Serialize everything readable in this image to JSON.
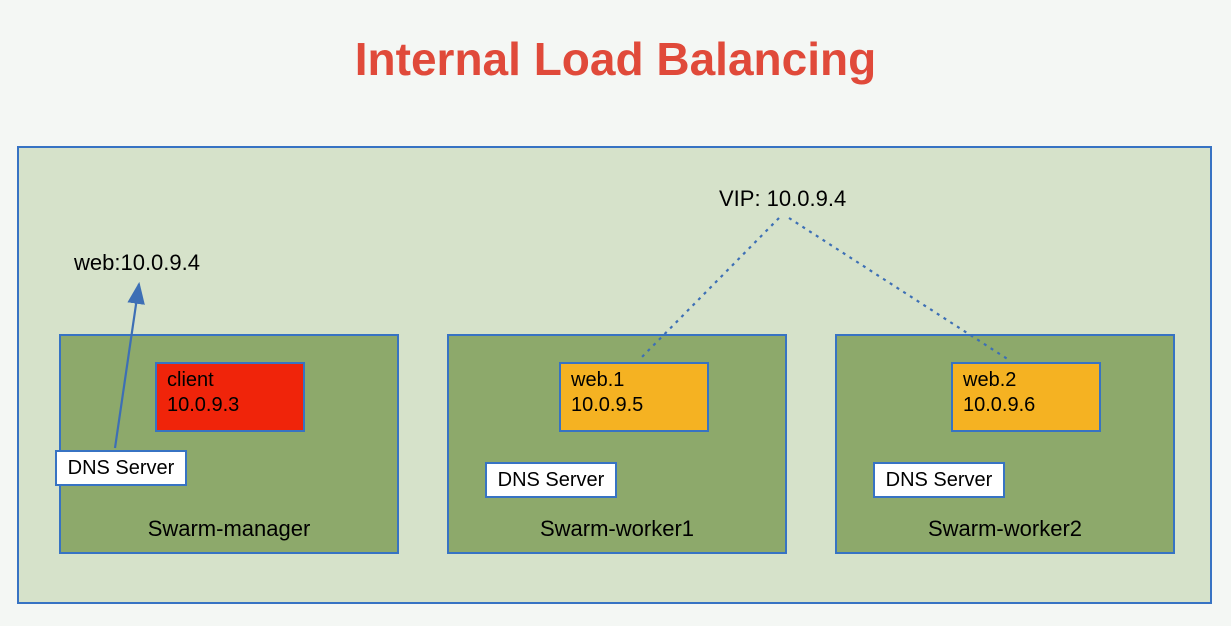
{
  "title": "Internal Load Balancing",
  "labels": {
    "vip": "VIP: 10.0.9.4",
    "web": "web:10.0.9.4",
    "dns": "DNS Server"
  },
  "nodes": {
    "manager": {
      "label": "Swarm-manager"
    },
    "worker1": {
      "label": "Swarm-worker1"
    },
    "worker2": {
      "label": "Swarm-worker2"
    }
  },
  "containers": {
    "client": {
      "name": "client",
      "ip": "10.0.9.3"
    },
    "web1": {
      "name": "web.1",
      "ip": "10.0.9.5"
    },
    "web2": {
      "name": "web.2",
      "ip": "10.0.9.6"
    }
  }
}
